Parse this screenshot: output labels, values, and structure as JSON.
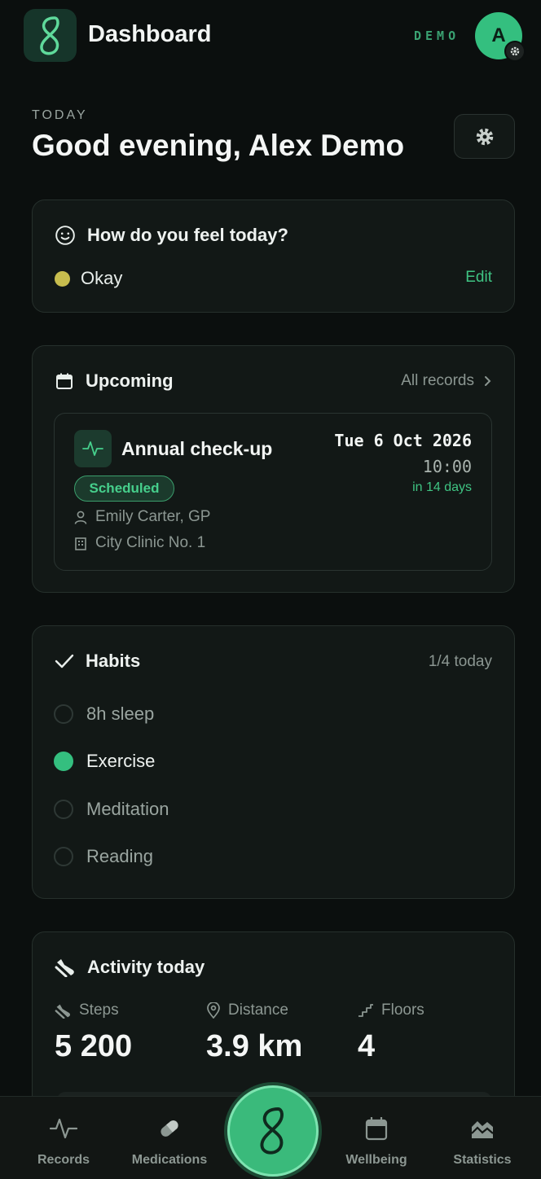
{
  "header": {
    "title": "Dashboard",
    "demo_label": "DEMO",
    "avatar_initial": "A"
  },
  "greeting": {
    "eyebrow": "TODAY",
    "text": "Good evening, Alex Demo"
  },
  "mood": {
    "title": "How do you feel today?",
    "value": "Okay",
    "edit_label": "Edit",
    "dot_color": "#c7bd4e"
  },
  "upcoming": {
    "title": "Upcoming",
    "all_records": "All records",
    "appointment": {
      "title": "Annual check-up",
      "status": "Scheduled",
      "doctor": "Emily Carter, GP",
      "clinic": "City Clinic No. 1",
      "date": "Tue 6 Oct 2026",
      "time": "10:00",
      "relative": "in 14 days"
    }
  },
  "habits": {
    "title": "Habits",
    "summary": "1/4 today",
    "items": [
      {
        "label": "8h sleep",
        "done": false
      },
      {
        "label": "Exercise",
        "done": true
      },
      {
        "label": "Meditation",
        "done": false
      },
      {
        "label": "Reading",
        "done": false
      }
    ]
  },
  "activity": {
    "title": "Activity today",
    "steps_label": "Steps",
    "steps_value": "5 200",
    "distance_label": "Distance",
    "distance_value": "3.9 km",
    "floors_label": "Floors",
    "floors_value": "4"
  },
  "nav": {
    "records": "Records",
    "medications": "Medications",
    "wellbeing": "Wellbeing",
    "statistics": "Statistics"
  },
  "colors": {
    "accent": "#34bf7f",
    "background": "#0b0f0e",
    "card": "#121816"
  }
}
